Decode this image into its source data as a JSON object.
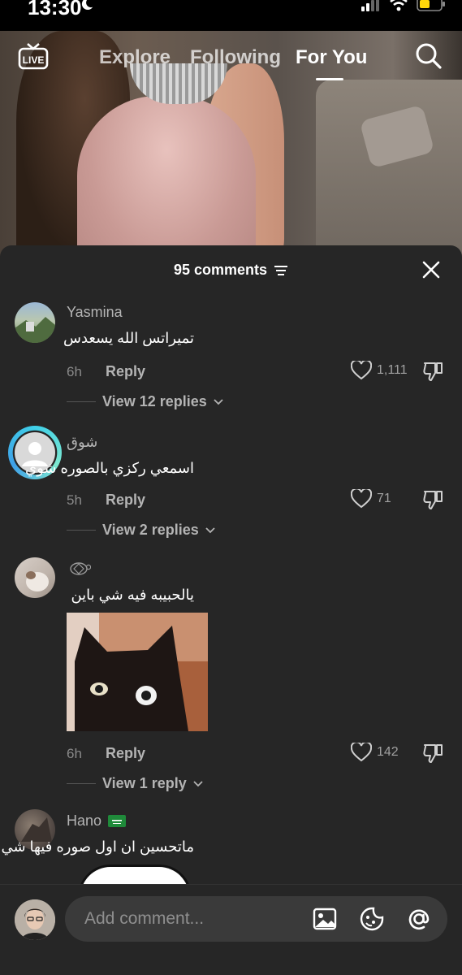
{
  "status_bar": {
    "time": "13:30"
  },
  "top_nav": {
    "tabs": [
      {
        "label": "Explore"
      },
      {
        "label": "Following"
      },
      {
        "label": "For You"
      }
    ]
  },
  "comments_sheet": {
    "count_label": "95 comments",
    "comments": [
      {
        "username": "Yasmina",
        "text": "تميراتس الله يسعدس",
        "time": "6h",
        "reply_label": "Reply",
        "likes": "1,111",
        "view_replies": "View 12 replies"
      },
      {
        "username": "شوق",
        "text": "اسمعي ركزي بالصوره شوي",
        "time": "5h",
        "reply_label": "Reply",
        "likes": "71",
        "view_replies": "View 2 replies"
      },
      {
        "username": "",
        "text": "يالحبيبه فيه شي باين",
        "time": "6h",
        "reply_label": "Reply",
        "likes": "142",
        "view_replies": "View 1 reply"
      },
      {
        "username": "Hano",
        "text": "ماتحسين ان اول صوره فيها شي"
      }
    ]
  },
  "composer": {
    "placeholder": "Add comment..."
  },
  "colors": {
    "sheet_bg": "#262626",
    "input_bg": "#3a3a3a",
    "story_ring": "#3fd0e8"
  }
}
